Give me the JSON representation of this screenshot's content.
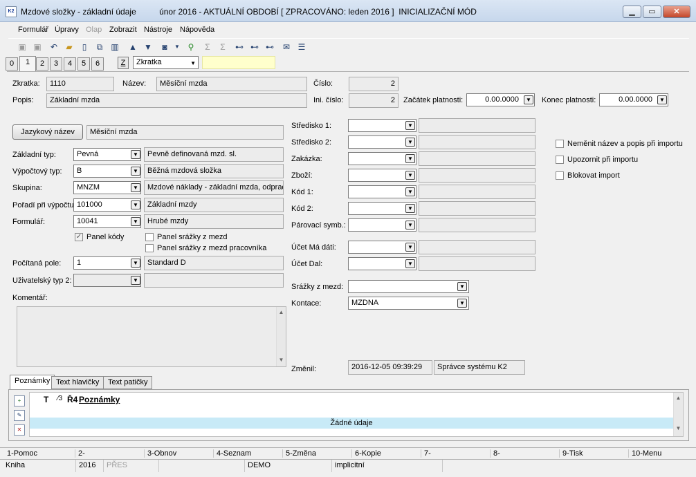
{
  "window": {
    "title": "Mzdové složky - základní údaje          únor 2016 - AKTUÁLNÍ OBDOBÍ [ ZPRACOVÁNO: leden 2016 ]  INICIALIZAČNÍ MÓD",
    "icon": "K2"
  },
  "menu": [
    "Formulář",
    "Úpravy",
    "Olap",
    "Zobrazit",
    "Nástroje",
    "Nápověda"
  ],
  "toolbar_icons": [
    "save-icon",
    "save-as-icon",
    "undo-icon",
    "open-folder-icon",
    "new-document-icon",
    "copy-icon",
    "book-icon",
    "arrow-up-icon",
    "arrow-down-icon",
    "camera-icon",
    "filter-icon",
    "sigma-icon",
    "sigma-filter-icon",
    "binoculars-icon",
    "binoculars-prev-icon",
    "binoculars-next-icon",
    "mail-icon",
    "list-icon"
  ],
  "tabs": [
    "0",
    "1",
    "2",
    "3",
    "4",
    "5",
    "6"
  ],
  "zkratka_button": "Z",
  "sort_combo": "Zkratka",
  "header": {
    "zkratka_label": "Zkratka:",
    "zkratka": "1110",
    "nazev_label": "Název:",
    "nazev": "Měsíční mzda",
    "cislo_label": "Číslo:",
    "cislo": "2",
    "popis_label": "Popis:",
    "popis": "Základní mzda",
    "ini_cislo_label": "Ini. číslo:",
    "ini_cislo": "2",
    "zacatek_label": "Začátek platnosti:",
    "zacatek": "0.00.0000",
    "konec_label": "Konec platnosti:",
    "konec": "0.00.0000"
  },
  "left": {
    "jazykovy_btn": "Jazykový název",
    "jazykovy_value": "Měsíční mzda",
    "rows": [
      {
        "label": "Základní typ:",
        "code": "Pevná",
        "desc": "Pevně definovaná mzd. sl."
      },
      {
        "label": "Výpočtový typ:",
        "code": "B",
        "desc": "Běžná mzdová složka"
      },
      {
        "label": "Skupina:",
        "code": "MNZM",
        "desc": "Mzdové náklady - základní mzda, odpraco"
      },
      {
        "label": "Pořadí při výpočtu:",
        "code": "101000",
        "desc": "Základní mzdy"
      },
      {
        "label": "Formulář:",
        "code": "10041",
        "desc": "Hrubé mzdy"
      }
    ],
    "cb_panel_kody": "Panel kódy",
    "cb_srazky": "Panel srážky z mezd",
    "cb_srazky_prac": "Panel srážky z mezd pracovníka",
    "pocitana_label": "Počítaná pole:",
    "pocitana_code": "1",
    "pocitana_desc": "Standard D",
    "uzivatel_label": "Uživatelský typ 2:",
    "uzivatel_code": "",
    "uzivatel_desc": "",
    "komentar_label": "Komentář:"
  },
  "middle": {
    "rows": [
      "Středisko 1:",
      "Středisko 2:",
      "Zakázka:",
      "Zboží:",
      "Kód 1:",
      "Kód 2:",
      "Párovací symb.:"
    ],
    "ucet_ma": "Účet Má dáti:",
    "ucet_dal": "Účet Dal:",
    "srazky_label": "Srážky z mezd:",
    "srazky_value": "",
    "kontace_label": "Kontace:",
    "kontace_value": "MZDNA",
    "zmenil_label": "Změnil:",
    "zmenil_date": "2016-12-05 09:39:29",
    "zmenil_user": "Správce systému K2"
  },
  "right": {
    "cb1": "Neměnit název a popis při importu",
    "cb2": "Upozornit při importu",
    "cb3": "Blokovat import"
  },
  "bottom_tabs": [
    "Poznámky",
    "Text hlavičky",
    "Text patičky"
  ],
  "notes": {
    "col_t": "T",
    "col_3": "3",
    "col_4": "Ř4",
    "col_title": "Poznámky",
    "empty": "Žádné údaje"
  },
  "fkeys": [
    "1-Pomoc",
    "2-",
    "3-Obnov",
    "4-Seznam",
    "5-Změna",
    "6-Kopie",
    "7-",
    "8-",
    "9-Tisk",
    "10-Menu"
  ],
  "status": [
    "Kniha",
    "2016",
    "PŘES",
    "",
    "DEMO",
    "implicitní"
  ]
}
